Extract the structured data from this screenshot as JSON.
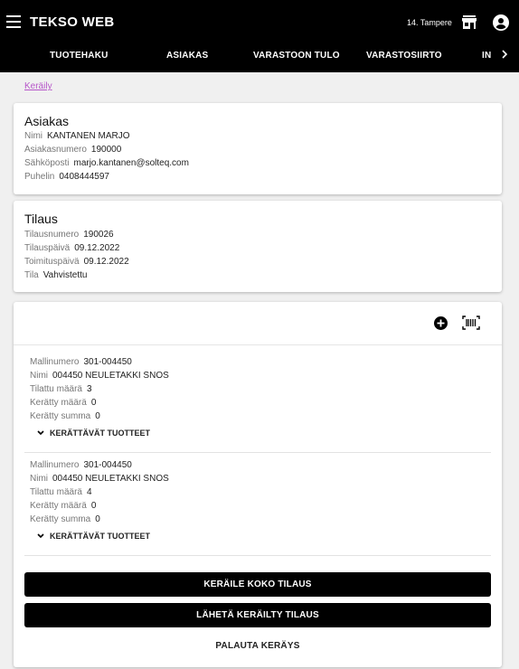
{
  "app": {
    "title": "TEKSO WEB",
    "store_name": "14. Tampere",
    "icons": {
      "menu": "menu-icon",
      "store": "store-icon",
      "account": "account-circle-icon"
    }
  },
  "tabs": [
    {
      "label": "TUOTEHAKU"
    },
    {
      "label": "ASIAKAS"
    },
    {
      "label": "VARASTOON TULO"
    },
    {
      "label": "VARASTOSIIRTO"
    },
    {
      "label": "IN"
    }
  ],
  "breadcrumb": {
    "label": "Keräily"
  },
  "customer": {
    "heading": "Asiakas",
    "fields": [
      {
        "key": "Nimi",
        "value": "KANTANEN MARJO"
      },
      {
        "key": "Asiakasnumero",
        "value": "190000"
      },
      {
        "key": "Sähköposti",
        "value": "marjo.kantanen@solteq.com"
      },
      {
        "key": "Puhelin",
        "value": "0408444597"
      }
    ]
  },
  "order": {
    "heading": "Tilaus",
    "fields": [
      {
        "key": "Tilausnumero",
        "value": "190026"
      },
      {
        "key": "Tilauspäivä",
        "value": "09.12.2022"
      },
      {
        "key": "Toimituspäivä",
        "value": "09.12.2022"
      },
      {
        "key": "Tila",
        "value": "Vahvistettu"
      }
    ]
  },
  "items": [
    {
      "fields": [
        {
          "key": "Mallinumero",
          "value": "301-004450"
        },
        {
          "key": "Nimi",
          "value": "004450 NEULETAKKI SNOS"
        },
        {
          "key": "Tilattu määrä",
          "value": "3"
        },
        {
          "key": "Kerätty määrä",
          "value": "0"
        },
        {
          "key": "Kerätty summa",
          "value": "0"
        }
      ],
      "expander": "KERÄTTÄVÄT TUOTTEET"
    },
    {
      "fields": [
        {
          "key": "Mallinumero",
          "value": "301-004450"
        },
        {
          "key": "Nimi",
          "value": "004450 NEULETAKKI SNOS"
        },
        {
          "key": "Tilattu määrä",
          "value": "4"
        },
        {
          "key": "Kerätty määrä",
          "value": "0"
        },
        {
          "key": "Kerätty summa",
          "value": "0"
        }
      ],
      "expander": "KERÄTTÄVÄT TUOTTEET"
    }
  ],
  "actions": {
    "collect_all": "KERÄILE KOKO TILAUS",
    "send_collected": "LÄHETÄ KERÄILTY TILAUS",
    "revert": "PALAUTA KERÄYS"
  },
  "colors": {
    "appbar": "#000000",
    "link": "#b655c9",
    "button": "#000000"
  }
}
